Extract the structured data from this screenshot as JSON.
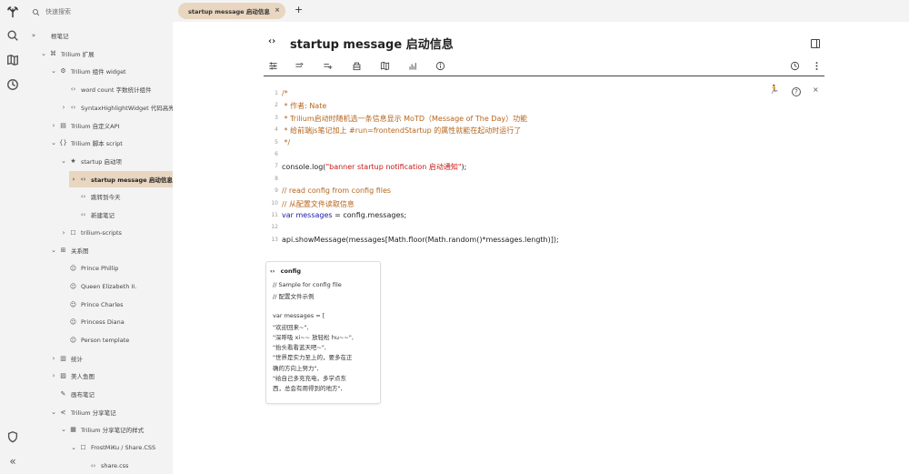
{
  "sidebar": {
    "search_placeholder": "快速搜索",
    "bottom_collapse": "«",
    "tree": [
      {
        "chevron": "»",
        "icon": "",
        "label": "根笔记"
      },
      {
        "chevron": "⌄",
        "icon": "⌘",
        "label": "Trilium 扩展"
      },
      {
        "chevron": "⌄",
        "icon": "⚙",
        "label": "Trilium 组件 widget"
      },
      {
        "chevron": "",
        "icon": "‹›",
        "label": "word count 字数统计组件"
      },
      {
        "chevron": "›",
        "icon": "‹›",
        "label": "SyntaxHighlightWidget 代码高亮"
      },
      {
        "chevron": "›",
        "icon": "▤",
        "label": "Trilium 自定义API"
      },
      {
        "chevron": "⌄",
        "icon": "{}",
        "label": "Trilium 脚本 script"
      },
      {
        "chevron": "⌄",
        "icon": "★",
        "label": "startup 启动项"
      },
      {
        "chevron": "›",
        "icon": "‹›",
        "label": "startup message 启动信息"
      },
      {
        "chevron": "",
        "icon": "‹›",
        "label": "跳转到今天"
      },
      {
        "chevron": "",
        "icon": "‹›",
        "label": "新建笔记"
      },
      {
        "chevron": "›",
        "icon": "☐",
        "label": "trilium-scripts"
      },
      {
        "chevron": "⌄",
        "icon": "⊞",
        "label": "关系图"
      },
      {
        "chevron": "",
        "icon": "☺",
        "label": "Prince Phillip"
      },
      {
        "chevron": "",
        "icon": "☺",
        "label": "Queen Elizabeth II."
      },
      {
        "chevron": "",
        "icon": "☺",
        "label": "Prince Charles"
      },
      {
        "chevron": "",
        "icon": "☺",
        "label": "Princess Diana"
      },
      {
        "chevron": "",
        "icon": "☺",
        "label": "Person template"
      },
      {
        "chevron": "›",
        "icon": "▥",
        "label": "统计"
      },
      {
        "chevron": "›",
        "icon": "▨",
        "label": "美人鱼图"
      },
      {
        "chevron": "",
        "icon": "✎",
        "label": "画布笔记"
      },
      {
        "chevron": "⌄",
        "icon": "⋞",
        "label": "Trilium 分享笔记"
      },
      {
        "chevron": "⌄",
        "icon": "▦",
        "label": "Trilium 分享笔记的样式"
      },
      {
        "chevron": "⌄",
        "icon": "☐",
        "label": "FrostMiKu / Share.CSS"
      },
      {
        "chevron": "",
        "icon": "‹›",
        "label": "share.css"
      }
    ]
  },
  "tab": {
    "label": "startup message 启动信息",
    "close": "×",
    "add": "+"
  },
  "note": {
    "type_icon": "‹›",
    "title": "startup message 启动信息"
  },
  "code_actions": {
    "run": "🏃",
    "help": "?",
    "close": "×"
  },
  "code": [
    {
      "n": "1",
      "text": "/*",
      "cls": "c-comment"
    },
    {
      "n": "2",
      "text": " * 作者: Nate",
      "cls": "c-comment"
    },
    {
      "n": "3",
      "text": " * Trilium启动时随机选一条信息显示 MoTD（Message of The Day）功能",
      "cls": "c-comment"
    },
    {
      "n": "4",
      "text": " * 给前端js笔记加上 #run=frontendStartup 的属性就能在起动时运行了",
      "cls": "c-comment"
    },
    {
      "n": "5",
      "text": " */",
      "cls": "c-comment"
    },
    {
      "n": "6",
      "text": "",
      "cls": "c-plain"
    },
    {
      "n": "7",
      "parts": [
        {
          "t": "console.log(",
          "c": "c-plain"
        },
        {
          "t": "\"banner startup notification 启动通知\"",
          "c": "c-str"
        },
        {
          "t": ");",
          "c": "c-plain"
        }
      ]
    },
    {
      "n": "8",
      "text": "",
      "cls": "c-plain"
    },
    {
      "n": "9",
      "text": "// read config from config files",
      "cls": "c-comment"
    },
    {
      "n": "10",
      "text": "// 从配置文件读取信息",
      "cls": "c-comment"
    },
    {
      "n": "11",
      "parts": [
        {
          "t": "var ",
          "c": "c-kw"
        },
        {
          "t": "messages",
          "c": "c-kw"
        },
        {
          "t": " = config.messages;",
          "c": "c-plain"
        }
      ]
    },
    {
      "n": "12",
      "text": "",
      "cls": "c-plain"
    },
    {
      "n": "13",
      "text": "api.showMessage(messages[Math.floor(Math.random()*messages.length)]);",
      "cls": "c-plain"
    }
  ],
  "included_note": {
    "icon": "‹›",
    "title": "config",
    "lines": [
      "// Sample for config file",
      "// 配置文件示例",
      "",
      "var messages = [",
      "    \"欢迎回来~\",",
      "    \"深呼吸 xi~~ 放轻松 hu~~\",",
      "    \"抬头看看蓝天吧~\",",
      "    \"世界是实力至上的，要多在正",
      "确的方向上努力\",",
      "    \"给自己多充充电，多学点东",
      "西，总会有用得到的地方\","
    ]
  }
}
